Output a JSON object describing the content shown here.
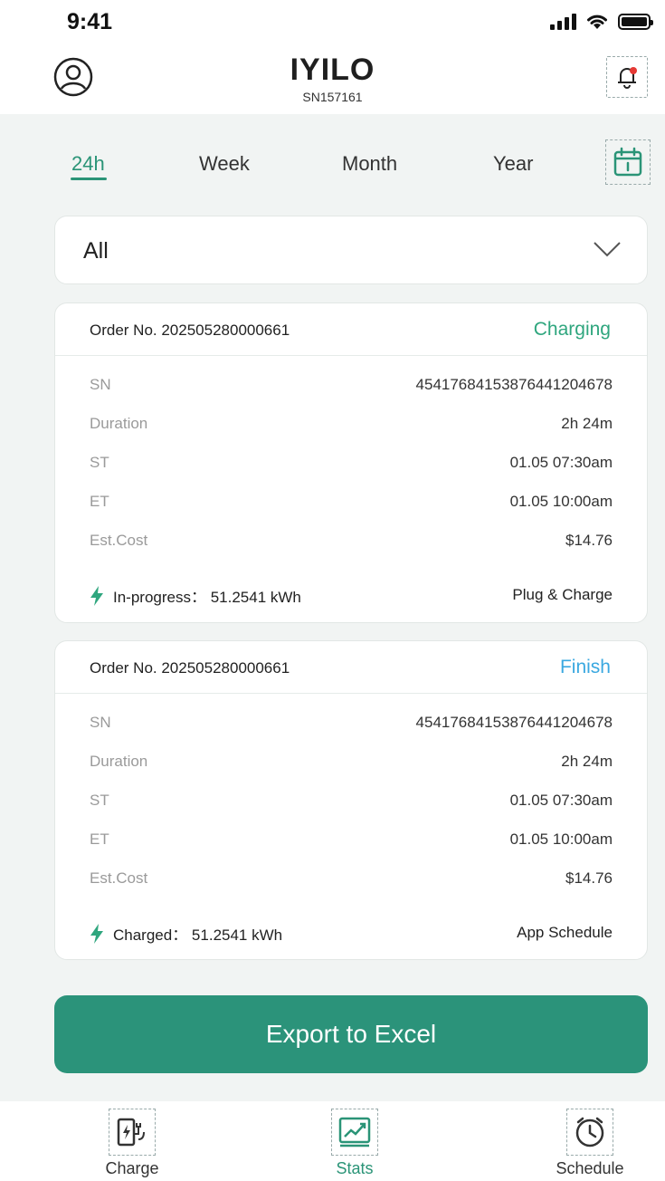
{
  "status_bar": {
    "time": "9:41"
  },
  "header": {
    "brand": "IYILO",
    "serial": "SN157161"
  },
  "tabs": [
    {
      "label": "24h",
      "active": true
    },
    {
      "label": "Week",
      "active": false
    },
    {
      "label": "Month",
      "active": false
    },
    {
      "label": "Year",
      "active": false
    }
  ],
  "filter": {
    "selected": "All"
  },
  "orders": [
    {
      "order_label": "Order No. 202505280000661",
      "status": "Charging",
      "status_color": "#2fa67e",
      "fields": [
        {
          "key": "SN",
          "value": "45417684153876441204678"
        },
        {
          "key": "Duration",
          "value": "2h 24m"
        },
        {
          "key": "ST",
          "value": "01.05 07:30am"
        },
        {
          "key": "ET",
          "value": "01.05 10:00am"
        },
        {
          "key": "Est.Cost",
          "value": "$14.76"
        }
      ],
      "energy_label": "In-progress： 51.2541 kWh",
      "mode": "Plug & Charge"
    },
    {
      "order_label": "Order No. 202505280000661",
      "status": "Finish",
      "status_color": "#3aa8e0",
      "fields": [
        {
          "key": "SN",
          "value": "45417684153876441204678"
        },
        {
          "key": "Duration",
          "value": "2h 24m"
        },
        {
          "key": "ST",
          "value": "01.05 07:30am"
        },
        {
          "key": "ET",
          "value": "01.05 10:00am"
        },
        {
          "key": "Est.Cost",
          "value": "$14.76"
        }
      ],
      "energy_label": "Charged： 51.2541 kWh",
      "mode": "App Schedule"
    }
  ],
  "export_button": "Export to Excel",
  "bottom_nav": [
    {
      "label": "Charge",
      "icon": "charger-icon",
      "active": false
    },
    {
      "label": "Stats",
      "icon": "stats-chart-icon",
      "active": true
    },
    {
      "label": "Schedule",
      "icon": "clock-icon",
      "active": false
    }
  ],
  "colors": {
    "accent": "#2a9477",
    "button": "#2b937a",
    "charging": "#2fa67e",
    "finish": "#3aa8e0",
    "background": "#f1f4f3"
  }
}
